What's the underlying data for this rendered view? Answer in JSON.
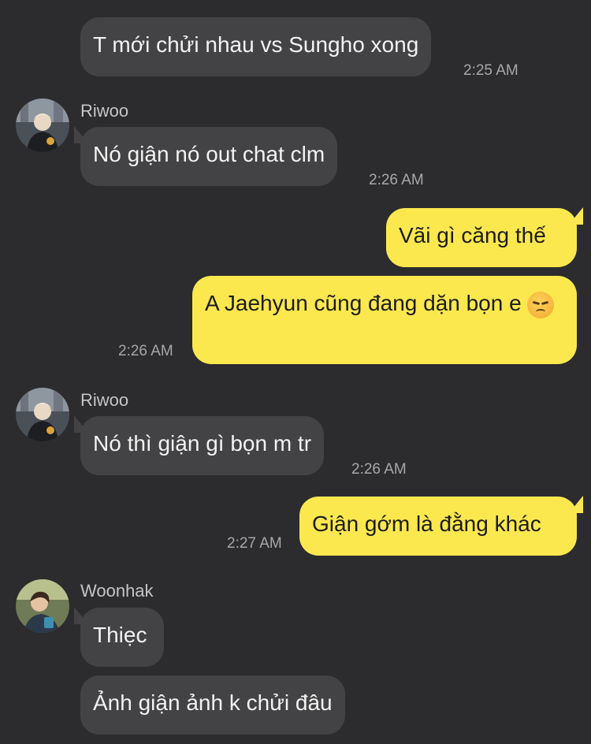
{
  "messages": {
    "m1": {
      "text": "T mới chửi nhau vs Sungho xong",
      "time": "2:25 AM"
    },
    "m2": {
      "sender": "Riwoo",
      "text": "Nó giận nó out chat clm",
      "time": "2:26 AM"
    },
    "m3": {
      "text": "Vãi gì căng thế"
    },
    "m4": {
      "text": "A Jaehyun cũng đang dặn bọn e",
      "emoji": "disappointed-face",
      "time": "2:26 AM"
    },
    "m5": {
      "sender": "Riwoo",
      "text": "Nó thì giận gì bọn m tr",
      "time": "2:26 AM"
    },
    "m6": {
      "text": "Giận gớm là đằng khác",
      "time": "2:27 AM"
    },
    "m7": {
      "sender": "Woonhak",
      "text": "Thiẹc"
    },
    "m8": {
      "text": "Ảnh giận ảnh k chửi đâu"
    }
  },
  "colors": {
    "background": "#2c2c2e",
    "incoming_bubble": "#434345",
    "outgoing_bubble": "#fbe84f",
    "timestamp": "#a7a7aa"
  }
}
